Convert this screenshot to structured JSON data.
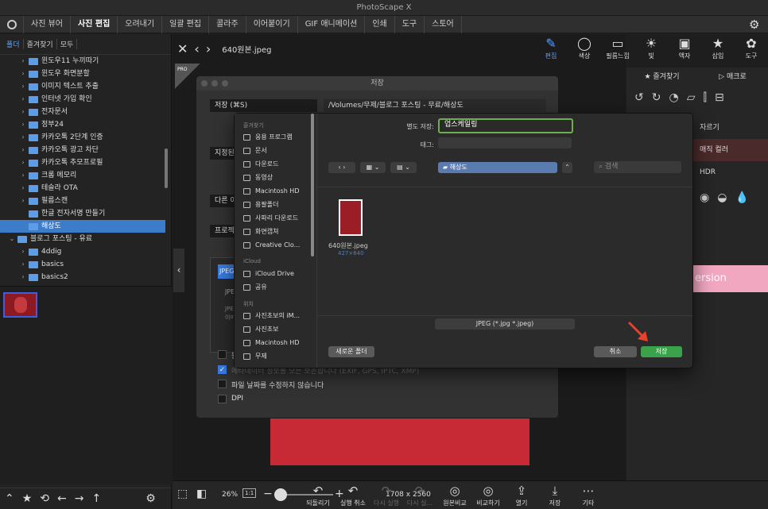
{
  "app": {
    "title": "PhotoScape X"
  },
  "menu": [
    "사진 뷰어",
    "사진 편집",
    "오려내기",
    "일괄 편집",
    "콜라주",
    "이어붙이기",
    "GIF 애니메이션",
    "인쇄",
    "도구",
    "스토어"
  ],
  "menu_active": "사진 편집",
  "left": {
    "tabs": [
      "폴더",
      "즐겨찾기",
      "모두"
    ],
    "tree": [
      {
        "label": "윈도우11 누끼따기",
        "arrow": "›",
        "indent": 1
      },
      {
        "label": "윈도우 화면분할",
        "arrow": "›",
        "indent": 1
      },
      {
        "label": "이미지 텍스트 추출",
        "arrow": "›",
        "indent": 1
      },
      {
        "label": "인터넷 가입 확인",
        "arrow": "›",
        "indent": 1
      },
      {
        "label": "전자문서",
        "arrow": "›",
        "indent": 1
      },
      {
        "label": "정부24",
        "arrow": "›",
        "indent": 1
      },
      {
        "label": "카카오톡 2단계 인증",
        "arrow": "›",
        "indent": 1
      },
      {
        "label": "카카오톡 광고 차단",
        "arrow": "›",
        "indent": 1
      },
      {
        "label": "카카오톡 추모프로필",
        "arrow": "›",
        "indent": 1
      },
      {
        "label": "크롬 메모리",
        "arrow": "›",
        "indent": 1
      },
      {
        "label": "테슬라 OTA",
        "arrow": "›",
        "indent": 1
      },
      {
        "label": "필름스캔",
        "arrow": "›",
        "indent": 1
      },
      {
        "label": "한글 전자서명 만들기",
        "arrow": "",
        "indent": 1
      },
      {
        "label": "해상도",
        "arrow": "",
        "indent": 1,
        "selected": true
      },
      {
        "label": "블로그 포스팅 - 유료",
        "arrow": "⌄",
        "indent": 0
      },
      {
        "label": "4ddig",
        "arrow": "›",
        "indent": 1
      },
      {
        "label": "basics",
        "arrow": "›",
        "indent": 1
      },
      {
        "label": "basics2",
        "arrow": "›",
        "indent": 1
      }
    ],
    "bottom_icons": [
      "up-chevron-icon",
      "star-icon",
      "rotate-icon",
      "back-arrow-icon",
      "forward-arrow-icon",
      "up-arrow-icon",
      "gear-icon"
    ]
  },
  "center": {
    "filename": "640원본.jpeg",
    "pro_badge": "PRO"
  },
  "right_tools": [
    {
      "label": "편집",
      "icon": "✎",
      "active": true
    },
    {
      "label": "색상",
      "icon": "◯"
    },
    {
      "label": "필름느낌",
      "icon": "▭"
    },
    {
      "label": "빛",
      "icon": "☀"
    },
    {
      "label": "액자",
      "icon": "▣"
    },
    {
      "label": "삽입",
      "icon": "★"
    },
    {
      "label": "도구",
      "icon": "✿"
    }
  ],
  "right_panel": {
    "tabs": [
      "★ 즐겨찾기",
      "▷ 매크로"
    ],
    "items": [
      "자르기",
      "매직 컬러",
      "HDR"
    ],
    "banner": "ersion"
  },
  "bottom": {
    "zoom": "26%",
    "zoom_one": "1:1",
    "size": "1708 x 2560",
    "actions": [
      {
        "label": "되돌리기",
        "icon": "↶"
      },
      {
        "label": "실행 취소",
        "icon": "↶"
      },
      {
        "label": "다시 실행",
        "icon": "↷",
        "dim": true
      },
      {
        "label": "다시 실...",
        "icon": "↷",
        "dim": true
      },
      {
        "label": "원본비교",
        "icon": "◎"
      },
      {
        "label": "비교하기",
        "icon": "◎"
      },
      {
        "label": "열기",
        "icon": "⇪"
      },
      {
        "label": "저장",
        "icon": "⤓"
      },
      {
        "label": "기타",
        "icon": "⋯"
      }
    ]
  },
  "save_dialog": {
    "title": "저장",
    "save_label": "저장  (⌘S)",
    "path": "/Volumes/무제/블로그 포스팅 - 무료/해상도",
    "opt1": "지정된",
    "opt2": "다른 이",
    "opt3": "프로젝",
    "format_box": "JPEG",
    "format_line1": "JPEG",
    "format_line2": "JPE",
    "format_line3": "이미",
    "check1": "원",
    "check2": "메타데이터 정보를 모든 보존합니다 (EXIF, GPS, IPTC, XMP)",
    "check3": "파일 날짜를 수정하지 않습니다",
    "check4": "DPI"
  },
  "file_sheet": {
    "sidebar": [
      {
        "type": "head",
        "label": "즐겨찾기"
      },
      {
        "type": "item",
        "label": "응용 프로그램"
      },
      {
        "type": "item",
        "label": "문서"
      },
      {
        "type": "item",
        "label": "다운로드"
      },
      {
        "type": "item",
        "label": "동영상"
      },
      {
        "type": "item",
        "label": "Macintosh HD"
      },
      {
        "type": "item",
        "label": "용팔폴더"
      },
      {
        "type": "item",
        "label": "사파리 다운로드"
      },
      {
        "type": "item",
        "label": "화면캡쳐"
      },
      {
        "type": "item",
        "label": "Creative Clo..."
      },
      {
        "type": "head",
        "label": "iCloud"
      },
      {
        "type": "item",
        "label": "iCloud Drive"
      },
      {
        "type": "item",
        "label": "공유"
      },
      {
        "type": "head",
        "label": "위치"
      },
      {
        "type": "item",
        "label": "사진초보의 iM..."
      },
      {
        "type": "item",
        "label": "사진초보"
      },
      {
        "type": "item",
        "label": "Macintosh HD"
      },
      {
        "type": "item",
        "label": "무제"
      }
    ],
    "save_as_label": "별도 저장:",
    "save_as_value": "업스케일링",
    "tags_label": "태그:",
    "folder": "해상도",
    "search_placeholder": "검색",
    "file_name": "640원본.jpeg",
    "file_dims": "427×640",
    "format": "JPEG (*.jpg *.jpeg)",
    "new_folder": "새로운 폴더",
    "cancel": "취소",
    "save": "저장"
  },
  "colors": {
    "accent": "#5aa0ff",
    "save_green": "#3aa24a",
    "arrow_red": "#e8412c"
  }
}
